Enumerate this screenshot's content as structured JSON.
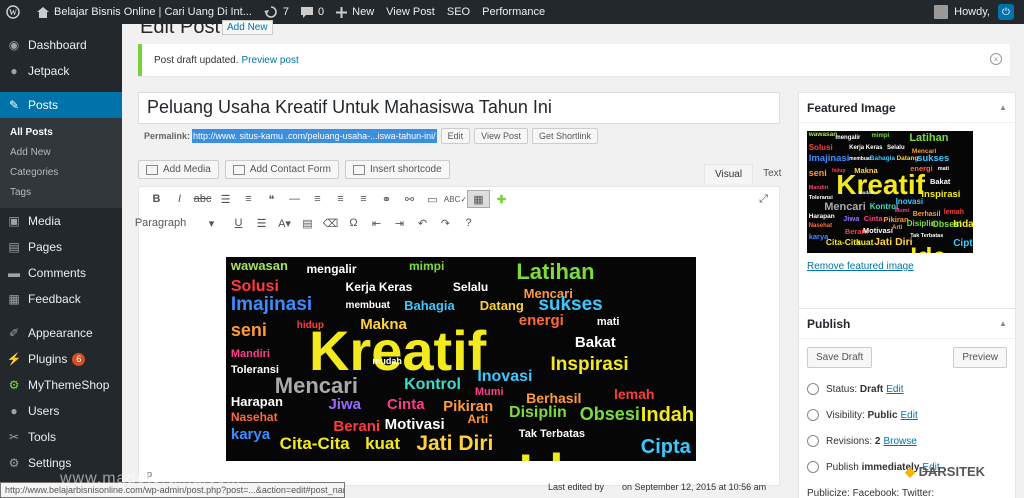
{
  "adminbar": {
    "site_title": "Belajar Bisnis Online | Cari Uang Di Int...",
    "updates_count": "7",
    "comments_count": "0",
    "new_label": "New",
    "view_post": "View Post",
    "seo": "SEO",
    "performance": "Performance",
    "howdy": "Howdy,"
  },
  "sidebar": {
    "items": [
      {
        "label": "Dashboard",
        "icon": "dashboard-icon"
      },
      {
        "label": "Jetpack",
        "icon": "jetpack-icon"
      },
      {
        "label": "Posts",
        "icon": "pin-icon"
      },
      {
        "label": "Media",
        "icon": "media-icon"
      },
      {
        "label": "Pages",
        "icon": "pages-icon"
      },
      {
        "label": "Comments",
        "icon": "comments-icon"
      },
      {
        "label": "Feedback",
        "icon": "feedback-icon"
      },
      {
        "label": "Appearance",
        "icon": "brush-icon"
      },
      {
        "label": "Plugins",
        "icon": "plugin-icon",
        "badge": "6"
      },
      {
        "label": "MyThemeShop",
        "icon": "gear-icon"
      },
      {
        "label": "Users",
        "icon": "users-icon"
      },
      {
        "label": "Tools",
        "icon": "wrench-icon"
      },
      {
        "label": "Settings",
        "icon": "settings-icon"
      }
    ],
    "posts_submenu": [
      "All Posts",
      "Add New",
      "Categories",
      "Tags"
    ]
  },
  "page": {
    "title": "Edit Post",
    "add_new": "Add New",
    "notice_text": "Post draft updated.",
    "notice_link": "Preview post"
  },
  "post": {
    "title": "Peluang Usaha Kreatif Untuk Mahasiswa Tahun Ini",
    "permalink_label": "Permalink:",
    "permalink_url": "http://www. situs-kamu .com/peluang-usaha-...iswa-tahun-ini/",
    "edit": "Edit",
    "view_post": "View Post",
    "get_shortlink": "Get Shortlink"
  },
  "editor": {
    "add_media": "Add Media",
    "add_contact_form": "Add Contact Form",
    "insert_shortcode": "Insert shortcode",
    "tab_visual": "Visual",
    "tab_text": "Text",
    "paragraph_select": "Paragraph",
    "path": "p",
    "last_edited_by": "Last edited by",
    "last_edited_on": "on September 12, 2015 at 10:56 am"
  },
  "featured_image": {
    "heading": "Featured Image",
    "remove": "Remove featured image"
  },
  "publish": {
    "heading": "Publish",
    "save_draft": "Save Draft",
    "preview": "Preview",
    "status_label": "Status:",
    "status_value": "Draft",
    "visibility_label": "Visibility:",
    "visibility_value": "Public",
    "revisions_label": "Revisions:",
    "revisions_value": "2",
    "browse": "Browse",
    "publish_label": "Publish",
    "publish_value": "immediately",
    "edit": "Edit",
    "publicize": "Publicize: Facebook: Twitter:"
  },
  "statusbar": {
    "url": "http://www.belajarbisnisonline.com/wp-admin/post.php?post=...&action=edit#post_name"
  },
  "watermark": "www.madeteraina.com",
  "logo_text": "DARSITEK",
  "word_cloud": [
    {
      "t": "wawasan",
      "c": "#a8e060"
    },
    {
      "t": "mengalir",
      "c": "#ffffff"
    },
    {
      "t": "mimpi",
      "c": "#7bdc3c"
    },
    {
      "t": "Latihan",
      "c": "#7bdc3c"
    },
    {
      "t": "Solusi",
      "c": "#ff3c3c"
    },
    {
      "t": "Kerja Keras",
      "c": "#ffffff"
    },
    {
      "t": "Selalu",
      "c": "#ffffff"
    },
    {
      "t": "Mencari",
      "c": "#ff9a3c"
    },
    {
      "t": "Imajinasi",
      "c": "#3c8cff"
    },
    {
      "t": "membuat",
      "c": "#ffffff"
    },
    {
      "t": "Bahagia",
      "c": "#3cc8ff"
    },
    {
      "t": "Datang",
      "c": "#ffd23c"
    },
    {
      "t": "sukses",
      "c": "#3cc8ff"
    },
    {
      "t": "seni",
      "c": "#ff9a3c"
    },
    {
      "t": "hidup",
      "c": "#ff3c3c"
    },
    {
      "t": "Makna",
      "c": "#ffd23c"
    },
    {
      "t": "energi",
      "c": "#ff6a3c"
    },
    {
      "t": "mati",
      "c": "#ffffff"
    },
    {
      "t": "Kreatif",
      "c": "#f2ea1e"
    },
    {
      "t": "Bakat",
      "c": "#ffffff"
    },
    {
      "t": "Mandiri",
      "c": "#ff3c8c"
    },
    {
      "t": "Inspirasi",
      "c": "#f2ea1e"
    },
    {
      "t": "Toleransi",
      "c": "#ffffff"
    },
    {
      "t": "Mencari",
      "c": "#aaaaaa"
    },
    {
      "t": "Kontrol",
      "c": "#3cdcc8"
    },
    {
      "t": "Inovasi",
      "c": "#3cc8ff"
    },
    {
      "t": "Berhasil",
      "c": "#ff9a3c"
    },
    {
      "t": "lemah",
      "c": "#ff3c3c"
    },
    {
      "t": "Harapan",
      "c": "#ffffff"
    },
    {
      "t": "Jiwa",
      "c": "#9a6aff"
    },
    {
      "t": "Cinta",
      "c": "#ff3c8c"
    },
    {
      "t": "Pikiran",
      "c": "#ff9a3c"
    },
    {
      "t": "Disiplin",
      "c": "#7bdc3c"
    },
    {
      "t": "Obsesi",
      "c": "#7bdc3c"
    },
    {
      "t": "Indah",
      "c": "#f2ea1e"
    },
    {
      "t": "Nasehat",
      "c": "#ff6a3c"
    },
    {
      "t": "Berani",
      "c": "#ff3c3c"
    },
    {
      "t": "Motivasi",
      "c": "#ffffff"
    },
    {
      "t": "Arti",
      "c": "#ff9a3c"
    },
    {
      "t": "karya",
      "c": "#3c8cff"
    },
    {
      "t": "Cita-Cita",
      "c": "#f2ea1e"
    },
    {
      "t": "kuat",
      "c": "#f2ea1e"
    },
    {
      "t": "Jati Diri",
      "c": "#ffd23c"
    },
    {
      "t": "Tak Terbatas",
      "c": "#ffffff"
    },
    {
      "t": "Cipta",
      "c": "#3cc8ff"
    },
    {
      "t": "Ide",
      "c": "#f2ea1e"
    },
    {
      "t": "Mumi",
      "c": "#ff3c8c"
    },
    {
      "t": "mudah",
      "c": "#ffffff"
    }
  ],
  "colors": {
    "adminbar_bg": "#23282d",
    "accent": "#0073aa",
    "notice_border": "#7ad03a",
    "link": "#0073aa"
  }
}
